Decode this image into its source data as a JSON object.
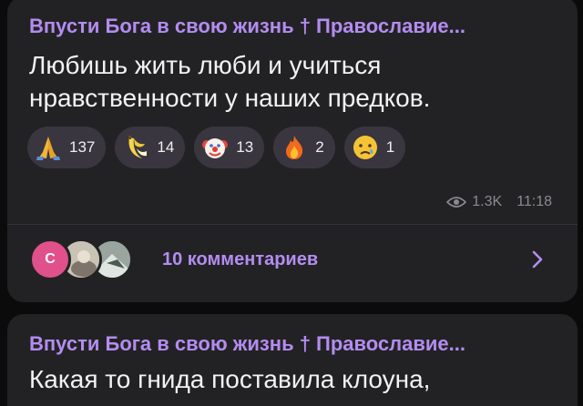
{
  "posts": [
    {
      "channel": "Впусти Бога в свою жизнь † Православие...",
      "text_line1": "Любишь жить люби и учиться",
      "text_line2": "нравственности у наших предков.",
      "reactions": [
        {
          "emoji": "folded-hands-icon",
          "count": "137"
        },
        {
          "emoji": "banana-icon",
          "count": "14"
        },
        {
          "emoji": "clown-face-icon",
          "count": "13"
        },
        {
          "emoji": "fire-icon",
          "count": "2"
        },
        {
          "emoji": "crying-face-icon",
          "count": "1"
        }
      ],
      "views": "1.3K",
      "time": "11:18",
      "comments": {
        "avatar_initial": "С",
        "label": "10 комментариев"
      }
    },
    {
      "channel": "Впусти Бога в свою жизнь † Православие...",
      "text_line1": "Какая то гнида поставила клоуна,"
    }
  ],
  "colors": {
    "background": "#0b0b0c",
    "bubble": "#222224",
    "accent": "#b48cf0",
    "reaction_pill": "#3a3640",
    "meta": "#8a8a90"
  }
}
